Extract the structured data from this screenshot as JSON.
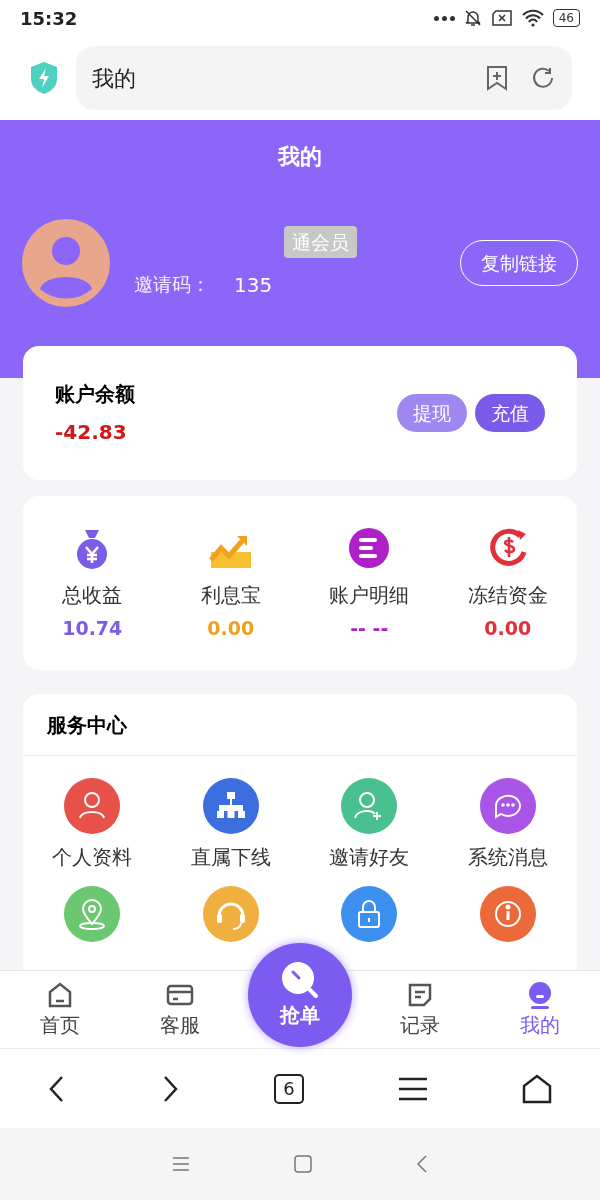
{
  "status_bar": {
    "time": "15:32",
    "battery": "46"
  },
  "browser": {
    "address": "我的"
  },
  "header": {
    "title": "我的",
    "badge": "通会员",
    "invite_label": "邀请码：",
    "invite_code": "135",
    "copy_button": "复制链接"
  },
  "balance": {
    "label": "账户余额",
    "value": "-42.83",
    "buttons": [
      {
        "label": "提现",
        "kind": "light"
      },
      {
        "label": "充值",
        "kind": "solid"
      }
    ]
  },
  "stats": [
    {
      "label": "总收益",
      "value": "10.74",
      "color": "#7b5ce6",
      "kind": "bag"
    },
    {
      "label": "利息宝",
      "value": "0.00",
      "color": "#f0a020",
      "kind": "chart"
    },
    {
      "label": "账户明细",
      "value": "-- --",
      "color": "#b020c8",
      "kind": "list"
    },
    {
      "label": "冻结资金",
      "value": "0.00",
      "color": "#e0303a",
      "kind": "dollar"
    }
  ],
  "services": {
    "title": "服务中心",
    "items": [
      {
        "label": "个人资料",
        "kind": "person",
        "color": "#e8504a"
      },
      {
        "label": "直属下线",
        "kind": "tree",
        "color": "#3d6ee0"
      },
      {
        "label": "邀请好友",
        "kind": "add-person",
        "color": "#48c090"
      },
      {
        "label": "系统消息",
        "kind": "chat",
        "color": "#a855e8"
      },
      {
        "kind": "pin",
        "color": "#6cc870"
      },
      {
        "kind": "headset",
        "color": "#f0b040"
      },
      {
        "kind": "lock",
        "color": "#3d90f0"
      },
      {
        "kind": "info",
        "color": "#ec6a3a"
      }
    ]
  },
  "tabs": [
    {
      "label": "首页",
      "kind": "home",
      "selected": false
    },
    {
      "label": "客服",
      "kind": "card",
      "selected": false
    },
    {
      "label": "抢单",
      "kind": "grab",
      "selected": false
    },
    {
      "label": "记录",
      "kind": "note",
      "selected": false
    },
    {
      "label": "我的",
      "kind": "me",
      "selected": true
    }
  ],
  "toolbar": {
    "tab_count": "6"
  }
}
